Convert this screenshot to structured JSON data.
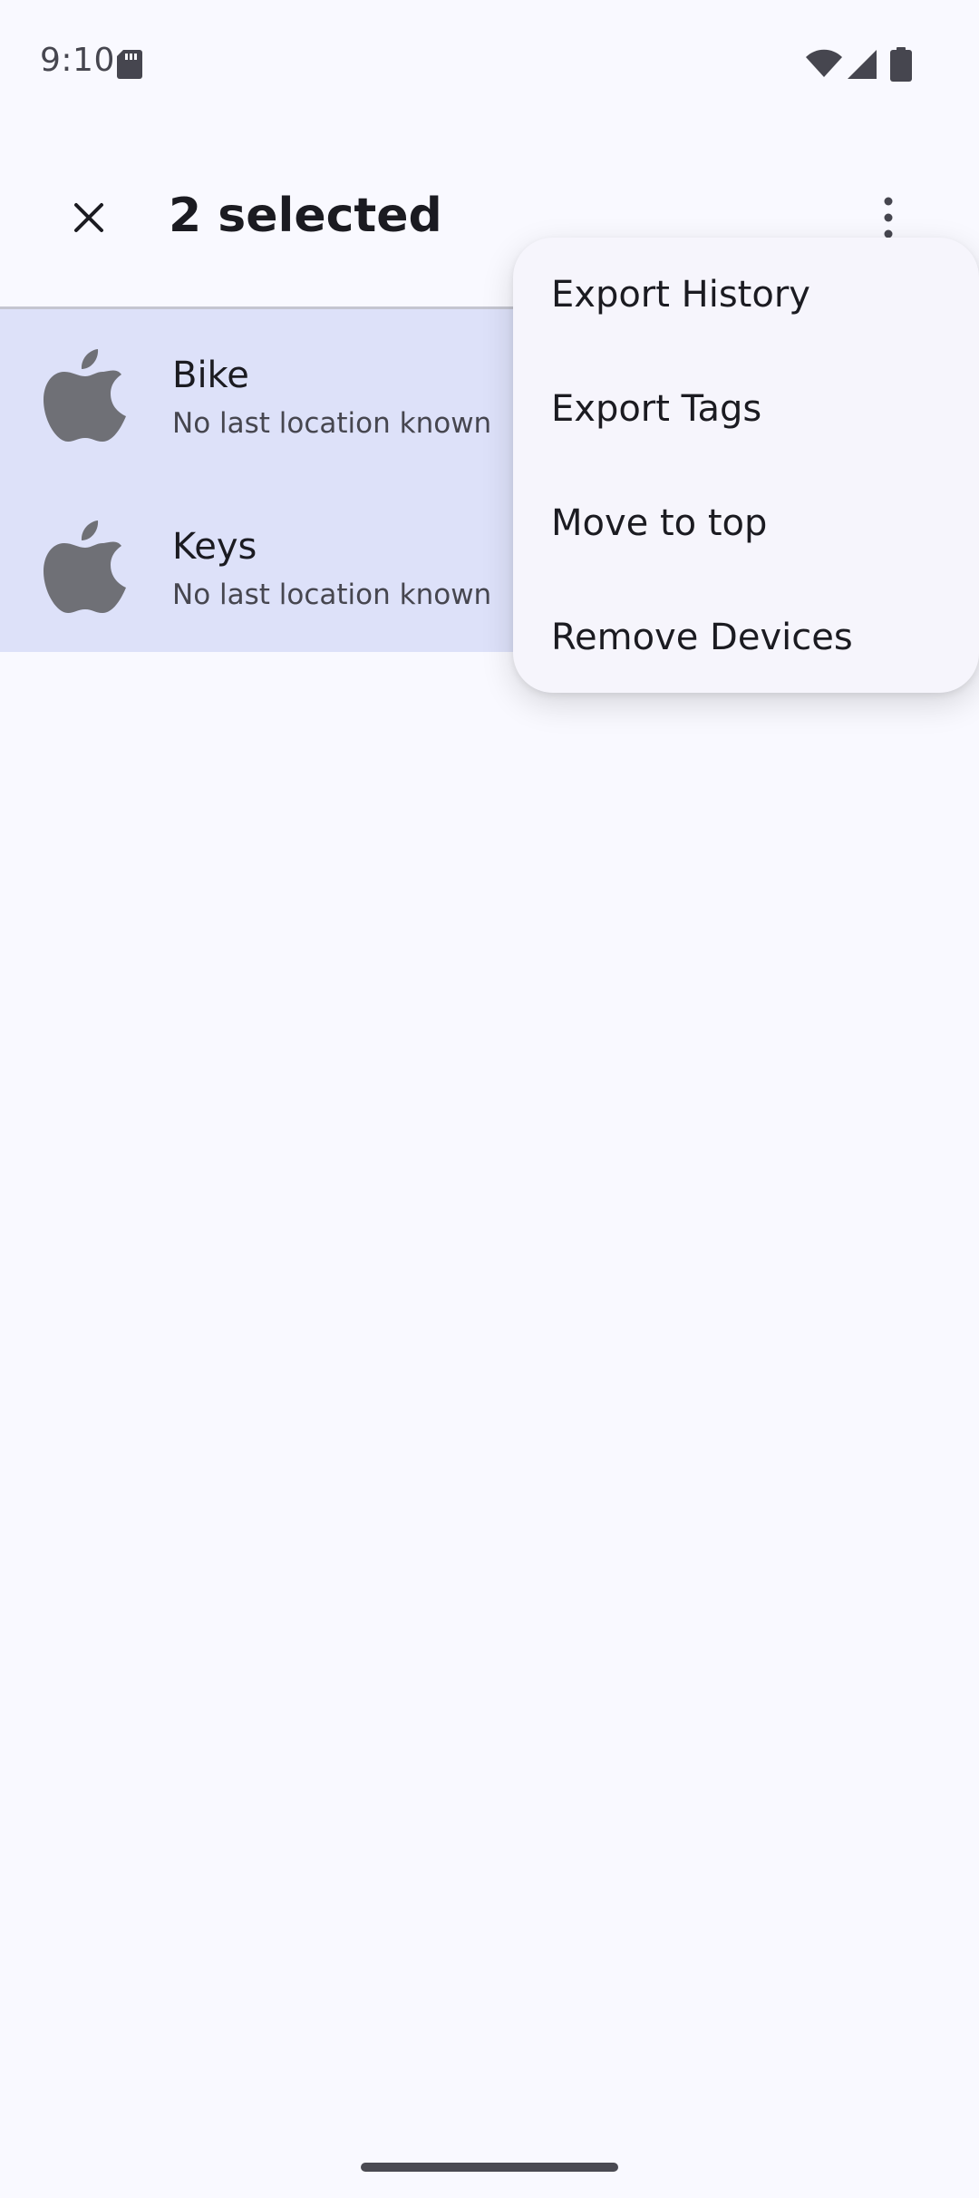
{
  "status_bar": {
    "time": "9:10",
    "icons": [
      "sd-card-icon",
      "wifi-icon",
      "cellular-signal-icon",
      "battery-icon"
    ]
  },
  "app_bar": {
    "title": "2 selected",
    "close_icon": "close-icon",
    "overflow_icon": "more-vert-icon"
  },
  "devices": [
    {
      "name": "Bike",
      "subtitle": "No last location known",
      "icon": "apple-icon"
    },
    {
      "name": "Keys",
      "subtitle": "No last location known",
      "icon": "apple-icon"
    }
  ],
  "menu": {
    "items": [
      {
        "label": "Export History"
      },
      {
        "label": "Export Tags"
      },
      {
        "label": "Move to top"
      },
      {
        "label": "Remove Devices"
      }
    ]
  },
  "colors": {
    "background": "#f9f9ff",
    "selected_row": "#dde1f9",
    "menu_surface": "#f6f5fc",
    "icon_gray": "#6f7076"
  }
}
